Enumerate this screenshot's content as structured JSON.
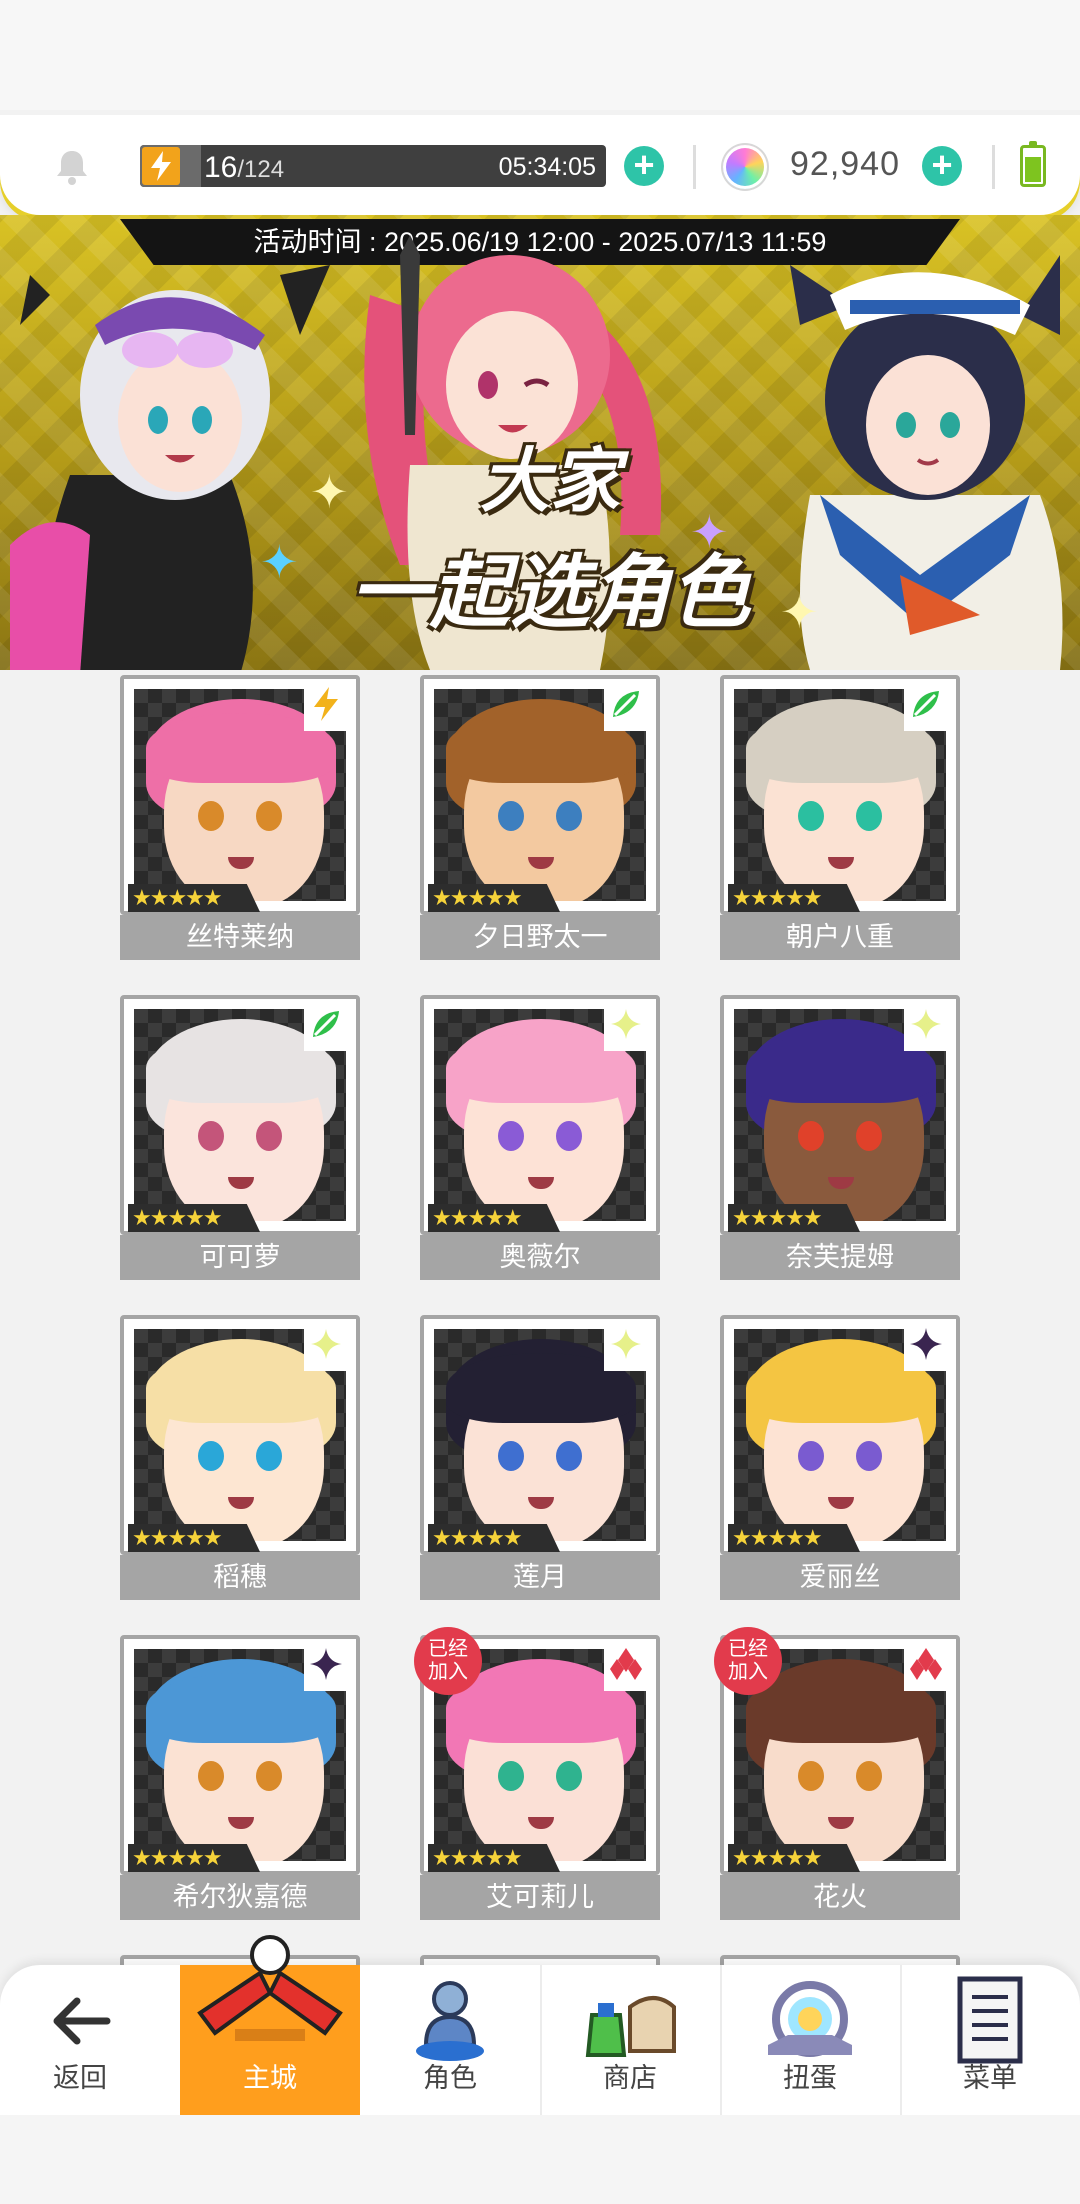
{
  "status": {
    "stamina_current": "16",
    "stamina_max": "/124",
    "stamina_fraction": 0.13,
    "stamina_timer": "05:34:05",
    "gems": "92,940"
  },
  "banner": {
    "event_time": "活动时间 : 2025.06/19 12:00 - 2025.07/13 11:59",
    "title_line1": "大家",
    "title_line2": "一起选角色"
  },
  "badge_text": [
    "已经",
    "加入"
  ],
  "characters": [
    {
      "name": "丝特莱纳",
      "stars": "★★★★★",
      "element": "lightning-icon",
      "hair": "#ee6fa7",
      "skin": "#f7d8c3",
      "eye": "#d98a2a",
      "bg": "#e6e6e6",
      "joined": false
    },
    {
      "name": "夕日野太一",
      "stars": "★★★★★",
      "element": "leaf-icon",
      "hair": "#a2622a",
      "skin": "#f3c9a0",
      "eye": "#3d7fbf",
      "bg": "#7a7a7a",
      "joined": false
    },
    {
      "name": "朝户八重",
      "stars": "★★★★★",
      "element": "leaf-icon",
      "hair": "#d6cfc2",
      "skin": "#fbe2d3",
      "eye": "#2bbfa0",
      "bg": "#eaeaea",
      "joined": false
    },
    {
      "name": "可可萝",
      "stars": "★★★★★",
      "element": "leaf-icon",
      "hair": "#e7e3e3",
      "skin": "#fbe4dc",
      "eye": "#c4557a",
      "bg": "#4a4a4a",
      "joined": false
    },
    {
      "name": "奥薇尔",
      "stars": "★★★★★",
      "element": "sparkle-icon",
      "hair": "#f7a3c8",
      "skin": "#fde2d6",
      "eye": "#8a5bd6",
      "bg": "#f7c6dc",
      "joined": false
    },
    {
      "name": "奈芙提姆",
      "stars": "★★★★★",
      "element": "sparkle-icon",
      "hair": "#3a2a8a",
      "skin": "#8a5a3d",
      "eye": "#e0412a",
      "bg": "#6f66c9",
      "joined": false
    },
    {
      "name": "稻穗",
      "stars": "★★★★★",
      "element": "sparkle-icon",
      "hair": "#f6dfa6",
      "skin": "#fde6d2",
      "eye": "#2aa7d8",
      "bg": "#f0d89a",
      "joined": false
    },
    {
      "name": "莲月",
      "stars": "★★★★★",
      "element": "sparkle-icon",
      "hair": "#232033",
      "skin": "#fbe2d6",
      "eye": "#3f6fd0",
      "bg": "#3b3b3b",
      "joined": false
    },
    {
      "name": "爱丽丝",
      "stars": "★★★★★",
      "element": "dark-star-icon",
      "hair": "#f4c542",
      "skin": "#fde3d3",
      "eye": "#7a5bd0",
      "bg": "#f29a3c",
      "joined": false
    },
    {
      "name": "希尔狄嘉德",
      "stars": "★★★★★",
      "element": "dark-star-icon",
      "hair": "#4c97d6",
      "skin": "#fbe2d3",
      "eye": "#d98a2a",
      "bg": "#3b4a6e",
      "joined": false
    },
    {
      "name": "艾可莉儿",
      "stars": "★★★★★",
      "element": "diamond-icon",
      "hair": "#f277b5",
      "skin": "#fbe0d6",
      "eye": "#2fb38f",
      "bg": "#e55fa0",
      "joined": true
    },
    {
      "name": "花火",
      "stars": "★★★★★",
      "element": "diamond-icon",
      "hair": "#6a3a2a",
      "skin": "#f8dccb",
      "eye": "#d98a2a",
      "bg": "#6a4a48",
      "joined": true
    }
  ],
  "nav": {
    "back": "返回",
    "main_city": "主城",
    "characters": "角色",
    "shop": "商店",
    "gacha": "扭蛋",
    "menu": "菜单"
  }
}
